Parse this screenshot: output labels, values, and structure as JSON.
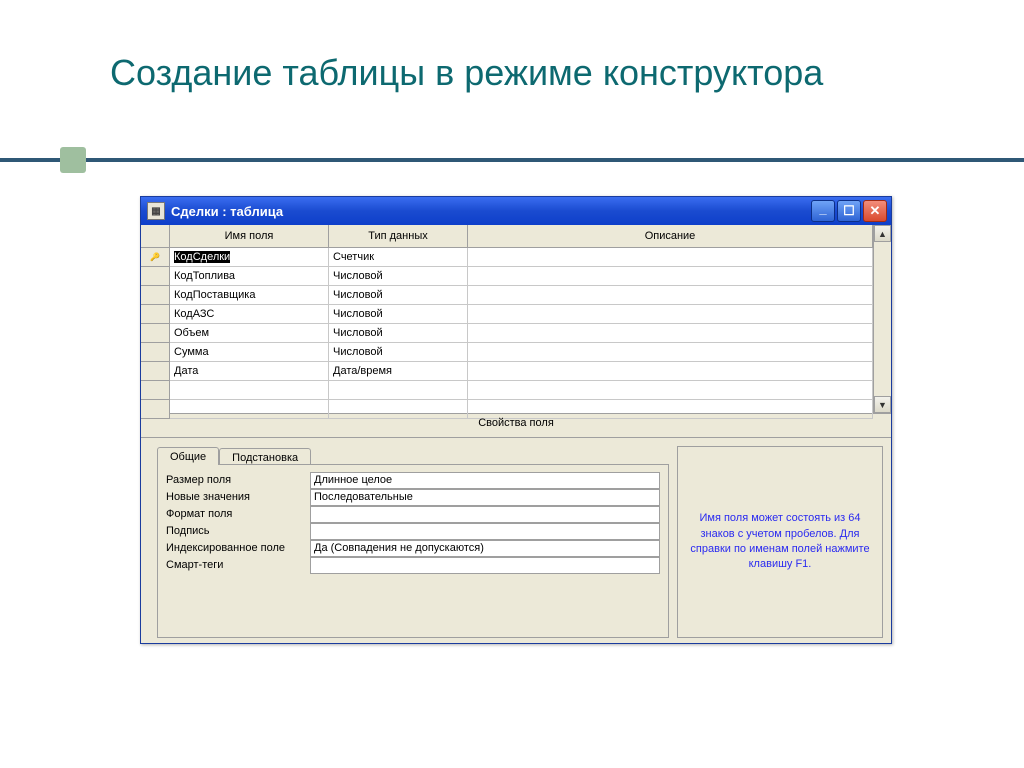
{
  "slide": {
    "title": "Создание таблицы в режиме конструктора"
  },
  "window": {
    "title": "Сделки : таблица",
    "columns": {
      "selector": "",
      "name": "Имя поля",
      "type": "Тип данных",
      "desc": "Описание"
    },
    "rows": [
      {
        "key": true,
        "name": "КодСделки",
        "type": "Счетчик",
        "desc": ""
      },
      {
        "key": false,
        "name": "КодТоплива",
        "type": "Числовой",
        "desc": ""
      },
      {
        "key": false,
        "name": "КодПоставщика",
        "type": "Числовой",
        "desc": ""
      },
      {
        "key": false,
        "name": "КодАЗС",
        "type": "Числовой",
        "desc": ""
      },
      {
        "key": false,
        "name": "Объем",
        "type": "Числовой",
        "desc": ""
      },
      {
        "key": false,
        "name": "Сумма",
        "type": "Числовой",
        "desc": ""
      },
      {
        "key": false,
        "name": "Дата",
        "type": "Дата/время",
        "desc": ""
      },
      {
        "key": false,
        "name": "",
        "type": "",
        "desc": ""
      },
      {
        "key": false,
        "name": "",
        "type": "",
        "desc": ""
      }
    ],
    "props_header": "Свойства поля",
    "tabs": {
      "general": "Общие",
      "lookup": "Подстановка"
    },
    "props": [
      {
        "label": "Размер поля",
        "value": "Длинное целое"
      },
      {
        "label": "Новые значения",
        "value": "Последовательные"
      },
      {
        "label": "Формат поля",
        "value": ""
      },
      {
        "label": "Подпись",
        "value": ""
      },
      {
        "label": "Индексированное поле",
        "value": "Да (Совпадения не допускаются)"
      },
      {
        "label": "Смарт-теги",
        "value": ""
      }
    ],
    "help": "Имя поля может состоять из 64 знаков с учетом пробелов.  Для справки по именам полей нажмите клавишу F1."
  }
}
